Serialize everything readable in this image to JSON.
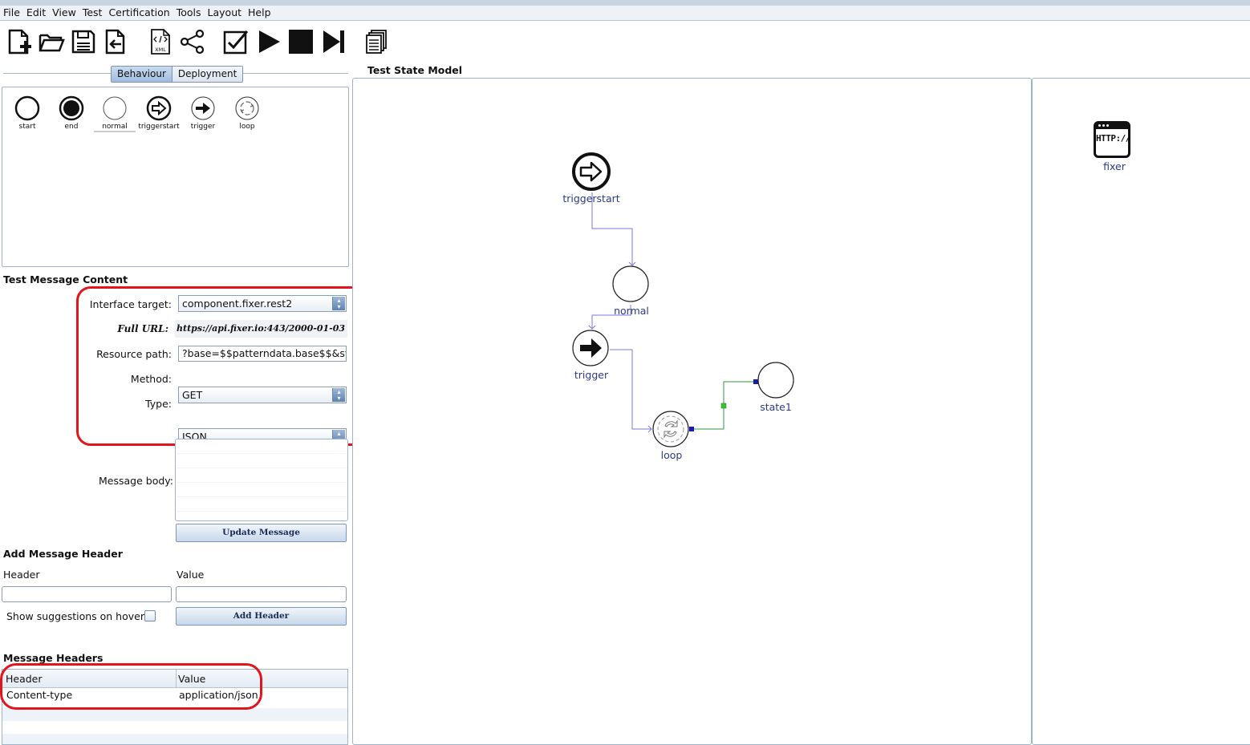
{
  "menubar": {
    "items": [
      "File",
      "Edit",
      "View",
      "Test",
      "Certification",
      "Tools",
      "Layout",
      "Help"
    ]
  },
  "toolbar": {
    "buttons": [
      "new-file-icon",
      "open-folder-icon",
      "save-icon",
      "export-icon",
      "xml-file-icon",
      "share-graph-icon",
      "check-icon",
      "play-icon",
      "stop-icon",
      "step-forward-icon",
      "copy-documents-icon"
    ],
    "xml_badge": "XML"
  },
  "left": {
    "tabs": [
      "Behaviour",
      "Deployment"
    ],
    "active_tab": "Behaviour",
    "palette": [
      "start",
      "end",
      "normal",
      "triggerstart",
      "trigger",
      "loop"
    ],
    "message_content": {
      "title": "Test Message Content",
      "interface_target_label": "Interface target:",
      "interface_target_value": "component.fixer.rest2",
      "full_url_label": "Full URL:",
      "full_url_value": "https://api.fixer.io:443/2000-01-03",
      "resource_path_label": "Resource path:",
      "resource_path_value": "?base=$$patterndata.base$$&sym",
      "method_label": "Method:",
      "method_value": "GET",
      "type_label": "Type:",
      "type_value": "JSON",
      "message_body_label": "Message body:",
      "update_button": "Update Message"
    },
    "add_header": {
      "title": "Add Message Header",
      "header_label": "Header",
      "value_label": "Value",
      "header_input": "",
      "value_input": "",
      "suggestions_label": "Show suggestions on hover:",
      "add_button": "Add Header"
    },
    "headers_table": {
      "title": "Message Headers",
      "columns": [
        "Header",
        "Value"
      ],
      "rows": [
        [
          "Content-type",
          "application/json"
        ]
      ]
    }
  },
  "canvas": {
    "title": "Test State Model",
    "nodes": [
      "triggerstart",
      "normal",
      "trigger",
      "loop",
      "state1"
    ]
  },
  "deployment": {
    "component_label": "fixer",
    "component_badge": "HTTP://"
  },
  "colors": {
    "highlight": "#e2141c",
    "node_label": "#2b3a86",
    "edge": "#7a7adb",
    "edge_green": "#2e9a3c"
  }
}
